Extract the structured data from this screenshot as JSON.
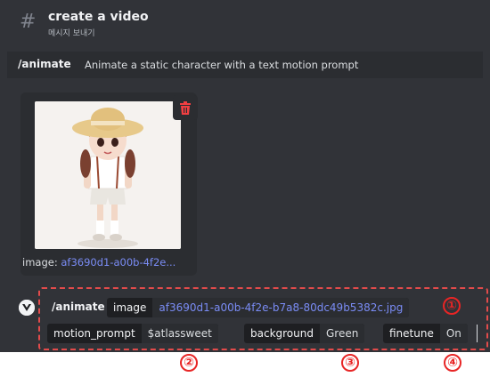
{
  "channel": {
    "title": "create a video",
    "subtitle": "메시지 보내기"
  },
  "command_bar": {
    "name": "/animate",
    "description": "Animate a static character with a text motion prompt"
  },
  "attachment": {
    "key": "image:",
    "filename": "af3690d1-a00b-4f2e..."
  },
  "command_input": {
    "command": "/animate",
    "options": [
      {
        "name": "image",
        "value": "af3690d1-a00b-4f2e-b7a8-80dc49b5382c.jpg"
      },
      {
        "name": "motion_prompt",
        "value": "$atlassweet"
      },
      {
        "name": "background",
        "value": "Green"
      },
      {
        "name": "finetune",
        "value": "On"
      }
    ]
  },
  "annotations": [
    "①",
    "②",
    "③",
    "④"
  ],
  "colors": {
    "background": "#313338",
    "accent_link": "#7a8cf5",
    "annotation": "#e82525",
    "trash": "#f23f42"
  }
}
